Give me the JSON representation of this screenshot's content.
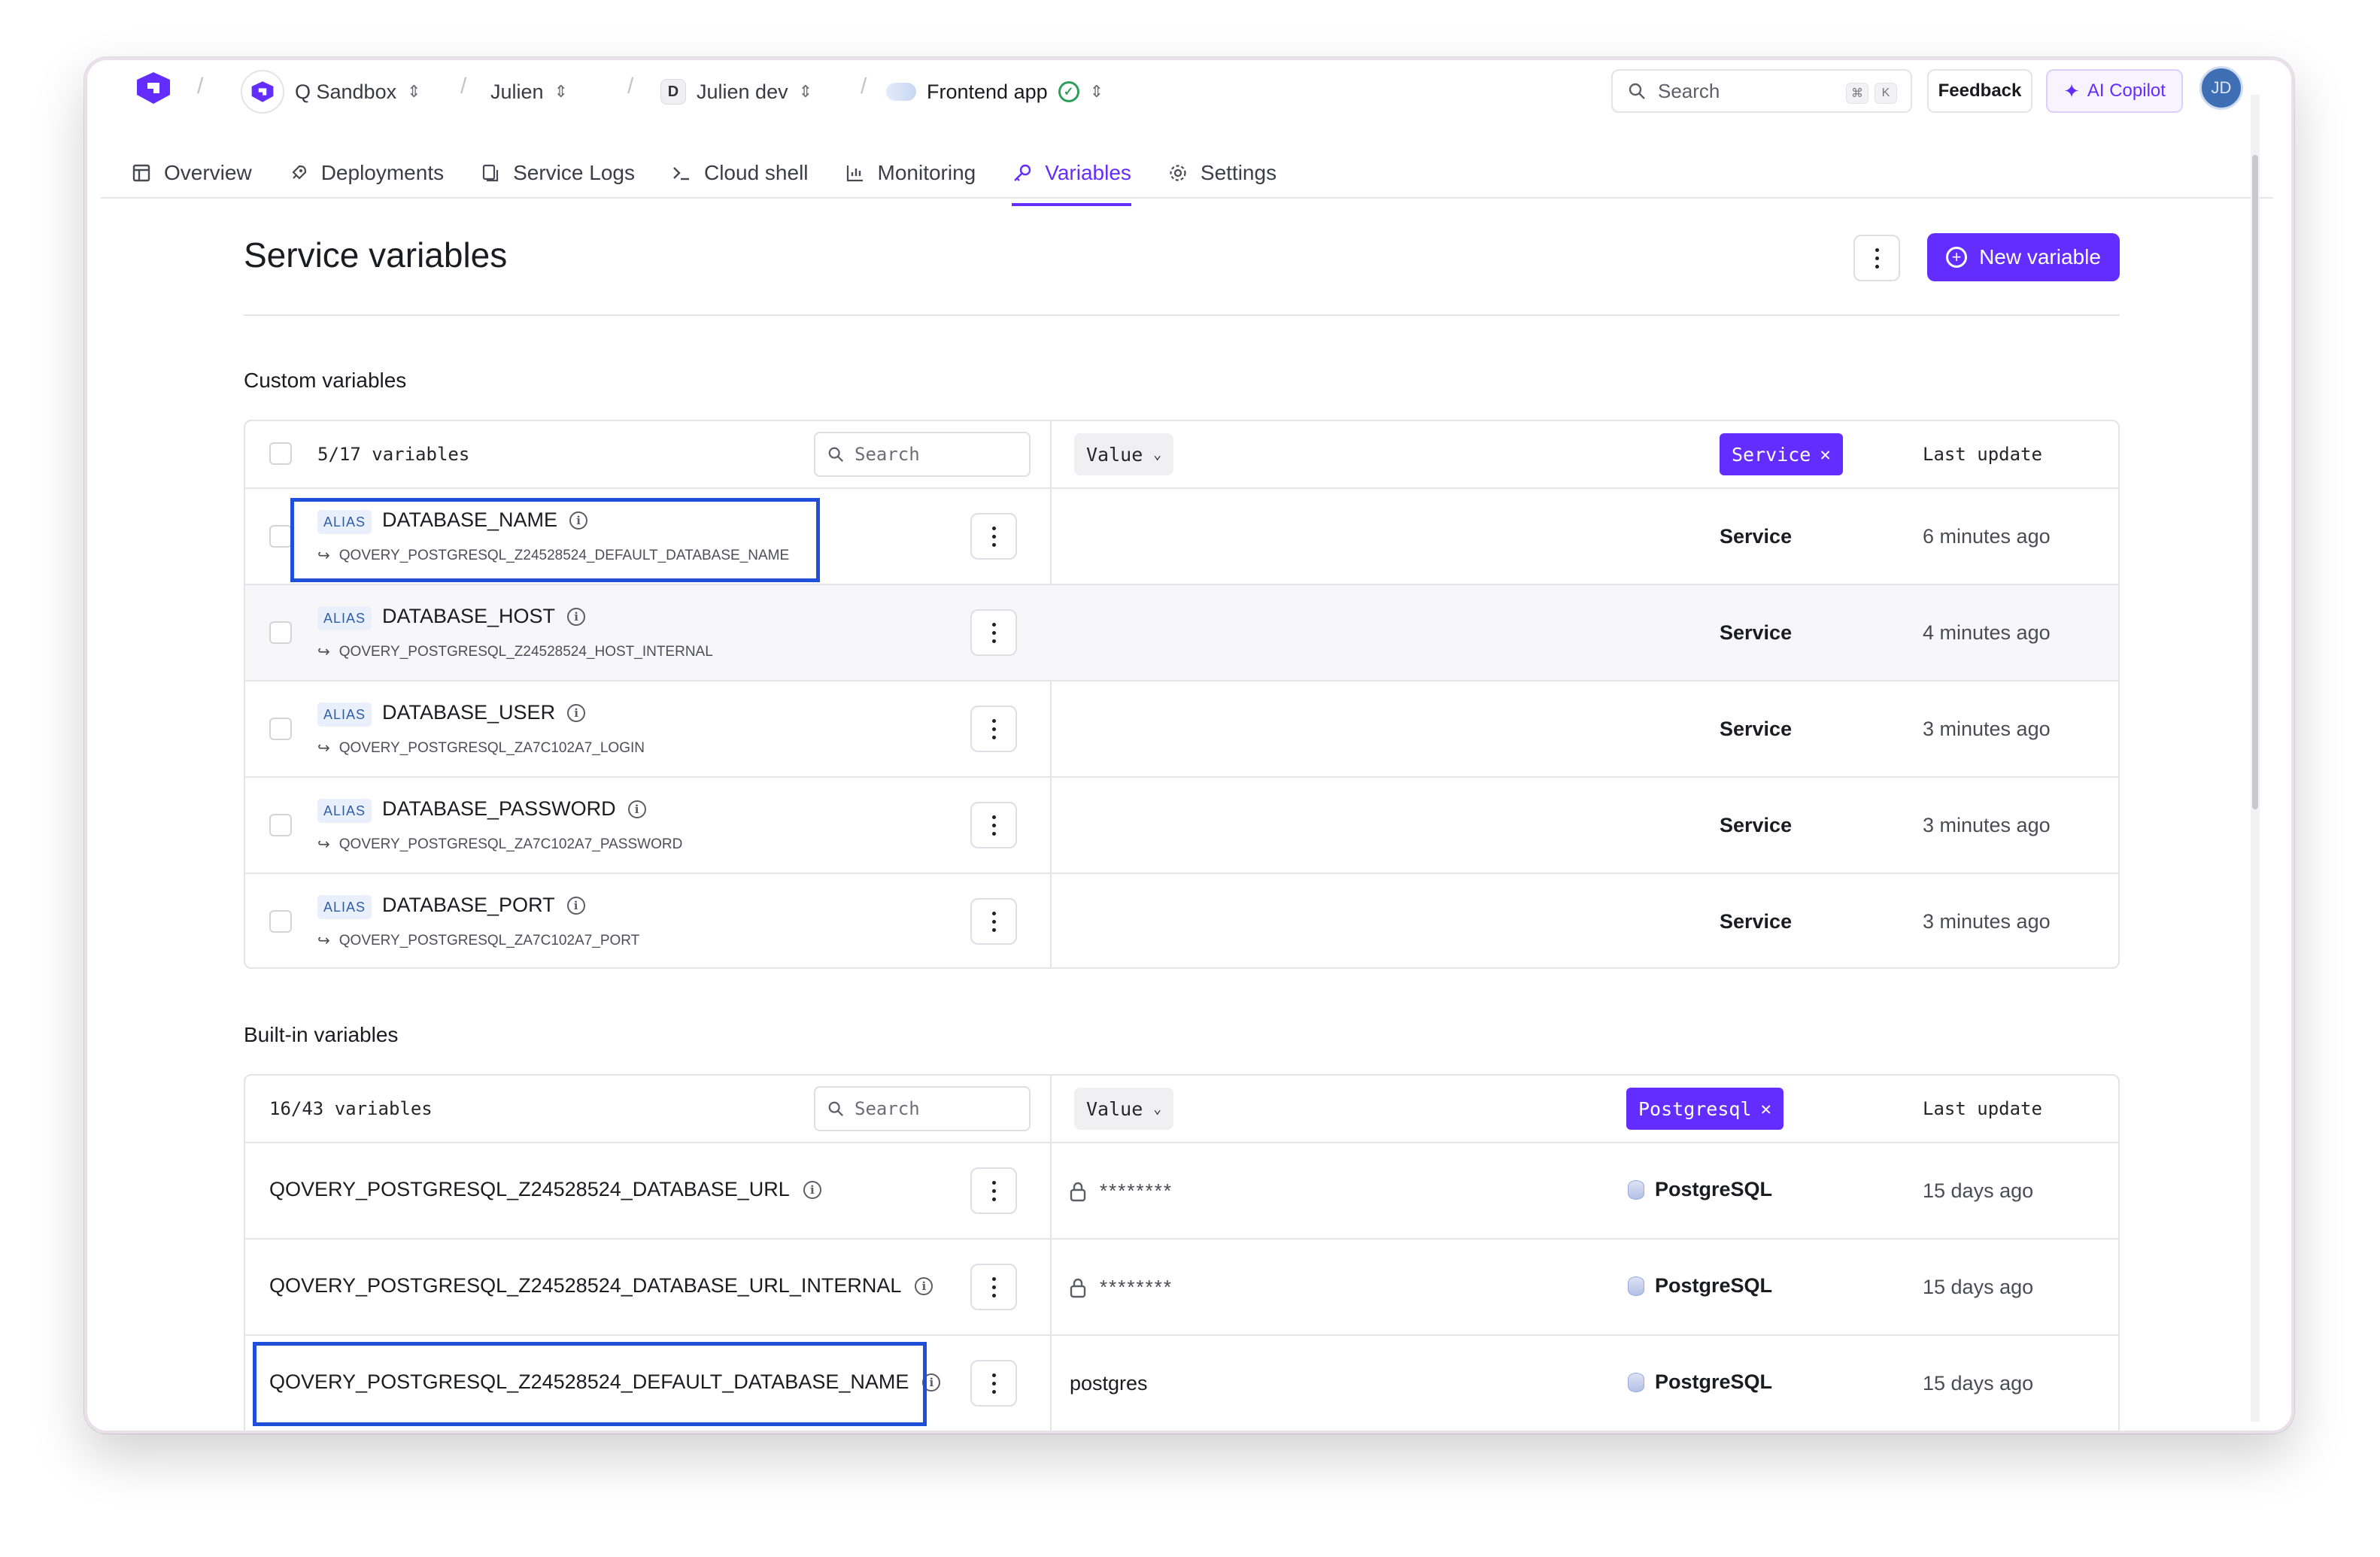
{
  "breadcrumb": {
    "org": "Q Sandbox",
    "project": "Julien",
    "environment_badge": "D",
    "environment": "Julien dev",
    "service": "Frontend app"
  },
  "header": {
    "search_placeholder": "Search",
    "kbd_cmd": "⌘",
    "kbd_k": "K",
    "feedback_label": "Feedback",
    "copilot_label": "AI Copilot",
    "user_initials": "JD"
  },
  "tabs": [
    {
      "label": "Overview",
      "icon": "layout-icon"
    },
    {
      "label": "Deployments",
      "icon": "rocket-icon"
    },
    {
      "label": "Service Logs",
      "icon": "logs-icon"
    },
    {
      "label": "Cloud shell",
      "icon": "terminal-icon"
    },
    {
      "label": "Monitoring",
      "icon": "chart-icon"
    },
    {
      "label": "Variables",
      "icon": "key-icon",
      "active": true
    },
    {
      "label": "Settings",
      "icon": "gear-icon"
    }
  ],
  "page": {
    "title": "Service variables",
    "new_variable_label": "New variable"
  },
  "custom": {
    "section_title": "Custom variables",
    "count": "5/17 variables",
    "search_placeholder": "Search",
    "value_dropdown": "Value",
    "filter_chip": "Service",
    "last_update_header": "Last update",
    "rows": [
      {
        "badge": "ALIAS",
        "name": "DATABASE_NAME",
        "ref": "QOVERY_POSTGRESQL_Z24528524_DEFAULT_DATABASE_NAME",
        "source": "Service",
        "time": "6 minutes ago"
      },
      {
        "badge": "ALIAS",
        "name": "DATABASE_HOST",
        "ref": "QOVERY_POSTGRESQL_Z24528524_HOST_INTERNAL",
        "source": "Service",
        "time": "4 minutes ago"
      },
      {
        "badge": "ALIAS",
        "name": "DATABASE_USER",
        "ref": "QOVERY_POSTGRESQL_ZA7C102A7_LOGIN",
        "source": "Service",
        "time": "3 minutes ago"
      },
      {
        "badge": "ALIAS",
        "name": "DATABASE_PASSWORD",
        "ref": "QOVERY_POSTGRESQL_ZA7C102A7_PASSWORD",
        "source": "Service",
        "time": "3 minutes ago"
      },
      {
        "badge": "ALIAS",
        "name": "DATABASE_PORT",
        "ref": "QOVERY_POSTGRESQL_ZA7C102A7_PORT",
        "source": "Service",
        "time": "3 minutes ago"
      }
    ]
  },
  "builtin": {
    "section_title": "Built-in variables",
    "count": "16/43 variables",
    "search_placeholder": "Search",
    "value_dropdown": "Value",
    "filter_chip": "Postgresql",
    "last_update_header": "Last update",
    "rows": [
      {
        "name": "QOVERY_POSTGRESQL_Z24528524_DATABASE_URL",
        "value": "********",
        "secret": true,
        "source": "PostgreSQL",
        "time": "15 days ago"
      },
      {
        "name": "QOVERY_POSTGRESQL_Z24528524_DATABASE_URL_INTERNAL",
        "value": "********",
        "secret": true,
        "source": "PostgreSQL",
        "time": "15 days ago"
      },
      {
        "name": "QOVERY_POSTGRESQL_Z24528524_DEFAULT_DATABASE_NAME",
        "value": "postgres",
        "secret": false,
        "source": "PostgreSQL",
        "time": "15 days ago"
      }
    ]
  },
  "colors": {
    "accent": "#642dff",
    "highlight_box": "#1f4fd8"
  }
}
